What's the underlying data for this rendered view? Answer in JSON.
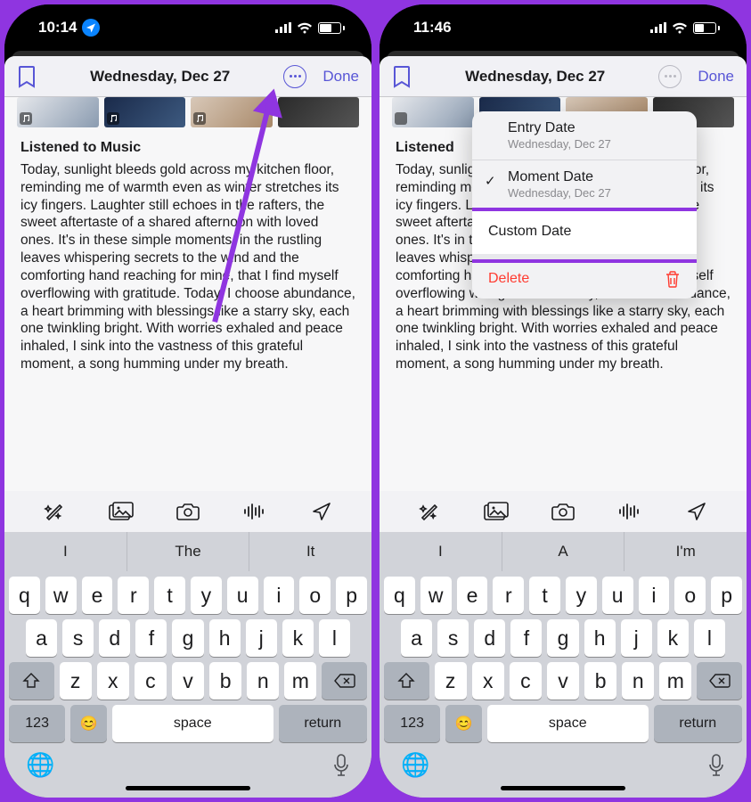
{
  "left": {
    "status": {
      "time": "10:14",
      "battery_pct": 57
    },
    "nav": {
      "title": "Wednesday, Dec 27",
      "done": "Done"
    },
    "entry": {
      "heading": "Listened to Music",
      "body": "Today, sunlight bleeds gold across my kitchen floor, reminding me of warmth even as winter stretches its icy fingers. Laughter still echoes in the rafters, the sweet aftertaste of a shared afternoon with loved ones. It's in these simple moments, in the rustling leaves whispering secrets to the wind and the comforting hand reaching for mine, that I find myself overflowing with gratitude. Today, I choose abundance, a heart brimming with blessings like a starry sky, each one twinkling bright. With worries exhaled and peace inhaled, I sink into the vastness of this grateful moment, a song humming under my breath."
    },
    "suggestions": [
      "I",
      "The",
      "It"
    ]
  },
  "right": {
    "status": {
      "time": "11:46",
      "battery_pct": 44
    },
    "nav": {
      "title": "Wednesday, Dec 27",
      "done": "Done"
    },
    "entry": {
      "heading": "Listened",
      "body": "Today, sunlight bleeds gold across my kitchen floor, reminding me of warmth even as winter stretches its icy fingers. Laughter still echoes in the rafters, the sweet aftertaste of a shared afternoon with loved ones. It's in these simple moments, in the rustling leaves whispering secrets to the wind and the comforting hand reaching for mine, that I find myself overflowing with gratitude. Today, I choose abundance, a heart brimming with blessings like a starry sky, each one twinkling bright. With worries exhaled and peace inhaled, I sink into the vastness of this grateful moment, a song humming under my breath."
    },
    "suggestions": [
      "I",
      "A",
      "I'm"
    ],
    "menu": {
      "entry_date": {
        "label": "Entry Date",
        "sub": "Wednesday, Dec 27"
      },
      "moment_date": {
        "label": "Moment Date",
        "sub": "Wednesday, Dec 27",
        "checked": true
      },
      "custom": "Custom Date",
      "delete": "Delete"
    }
  },
  "keyboard": {
    "row1": [
      "q",
      "w",
      "e",
      "r",
      "t",
      "y",
      "u",
      "i",
      "o",
      "p"
    ],
    "row2": [
      "a",
      "s",
      "d",
      "f",
      "g",
      "h",
      "j",
      "k",
      "l"
    ],
    "row3": [
      "z",
      "x",
      "c",
      "v",
      "b",
      "n",
      "m"
    ],
    "numkey": "123",
    "space": "space",
    "return": "return"
  }
}
